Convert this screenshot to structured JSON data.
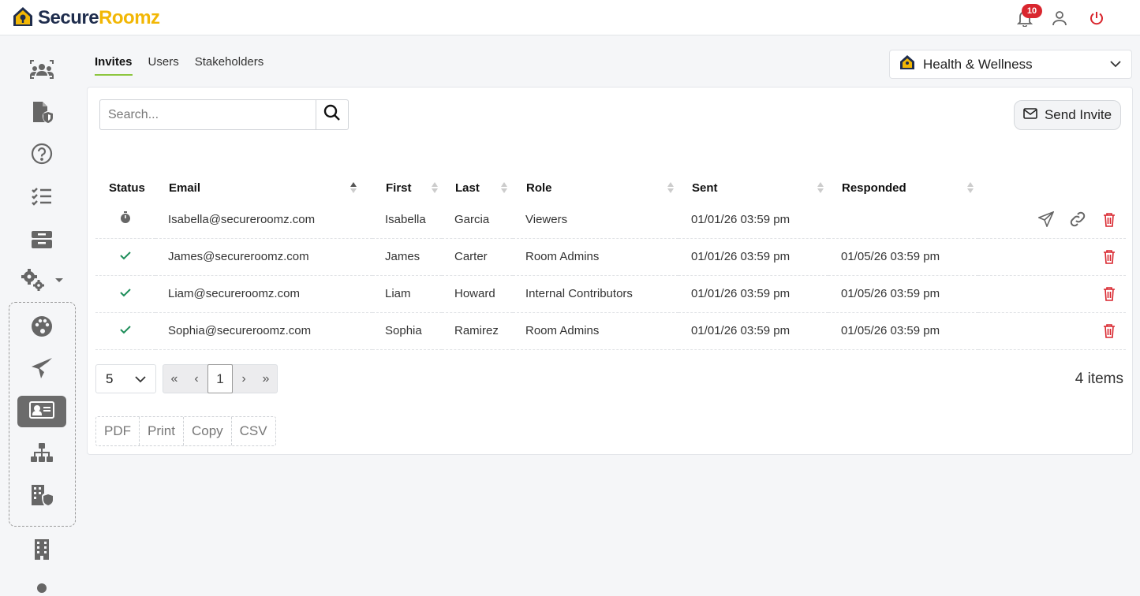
{
  "brand": {
    "name_part1": "Secure",
    "name_part2": "Roomz",
    "color_dark": "#1f2d4d",
    "color_accent": "#f2b705"
  },
  "header": {
    "notifications": {
      "icon": "bell-icon",
      "count": "10"
    },
    "profile_icon": "user-icon",
    "logout_icon": "power-icon"
  },
  "sidebar": {
    "items": [
      {
        "icon": "users-group-icon"
      },
      {
        "icon": "file-shield-icon"
      },
      {
        "icon": "help-circle-icon"
      },
      {
        "icon": "checklist-icon"
      },
      {
        "icon": "inbox-tray-icon"
      },
      {
        "icon": "settings-gears-icon"
      },
      {
        "icon": "palette-icon"
      },
      {
        "icon": "send-icon"
      },
      {
        "icon": "id-card-icon",
        "active": true
      },
      {
        "icon": "sitemap-icon"
      },
      {
        "icon": "building-shield-icon"
      },
      {
        "icon": "building-icon"
      }
    ]
  },
  "tabs": [
    "Invites",
    "Users",
    "Stakeholders"
  ],
  "room_selector": {
    "value": "Health & Wellness"
  },
  "search": {
    "placeholder": "Search..."
  },
  "send_invite_label": "Send Invite",
  "table": {
    "headers": {
      "status": "Status",
      "email": "Email",
      "first": "First",
      "last": "Last",
      "role": "Role",
      "sent": "Sent",
      "responded": "Responded"
    },
    "rows": [
      {
        "status": "pending",
        "email": "Isabella@secureroomz.com",
        "first": "Isabella",
        "last": "Garcia",
        "role": "Viewers",
        "sent": "01/01/26 03:59 pm",
        "responded": ""
      },
      {
        "status": "accepted",
        "email": "James@secureroomz.com",
        "first": "James",
        "last": "Carter",
        "role": "Room Admins",
        "sent": "01/01/26 03:59 pm",
        "responded": "01/05/26 03:59 pm"
      },
      {
        "status": "accepted",
        "email": "Liam@secureroomz.com",
        "first": "Liam",
        "last": "Howard",
        "role": "Internal Contributors",
        "sent": "01/01/26 03:59 pm",
        "responded": "01/05/26 03:59 pm"
      },
      {
        "status": "accepted",
        "email": "Sophia@secureroomz.com",
        "first": "Sophia",
        "last": "Ramirez",
        "role": "Room Admins",
        "sent": "01/01/26 03:59 pm",
        "responded": "01/05/26 03:59 pm"
      }
    ]
  },
  "pagination": {
    "page_size": "5",
    "first": "«",
    "prev": "‹",
    "current": "1",
    "next": "›",
    "last": "»",
    "items_count": "4 items"
  },
  "exports": [
    "PDF",
    "Print",
    "Copy",
    "CSV"
  ],
  "colors": {
    "accept_green": "#1e8e5a",
    "delete_red": "#d9262e",
    "tab_underline": "#8dc63f",
    "active_sidebar": "#6b6b6b"
  }
}
